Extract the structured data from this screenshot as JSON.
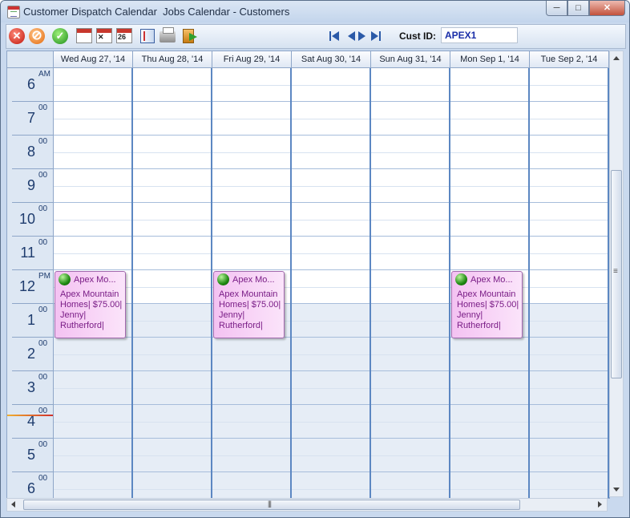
{
  "window": {
    "title": "Customer Dispatch Calendar  Jobs Calendar - Customers",
    "controls": {
      "minimize": "─",
      "maximize": "□",
      "close": "✕"
    }
  },
  "toolbar": {
    "buttons": [
      {
        "name": "delete-icon",
        "glyph": "✕"
      },
      {
        "name": "cancel-icon",
        "glyph": "⊘"
      },
      {
        "name": "confirm-icon",
        "glyph": "✓"
      },
      {
        "name": "go-to-today-icon",
        "glyph": ""
      },
      {
        "name": "delete-appointment-icon",
        "glyph": "✕"
      },
      {
        "name": "go-to-date-icon",
        "glyph": "26"
      },
      {
        "name": "notebook-icon",
        "glyph": ""
      },
      {
        "name": "printer-icon",
        "glyph": ""
      },
      {
        "name": "exit-door-icon",
        "glyph": ""
      }
    ],
    "nav": [
      "first-record-icon",
      "previous-record-icon",
      "next-record-icon",
      "last-record-icon"
    ],
    "cust_label": "Cust ID:",
    "cust_value": "APEX1"
  },
  "calendar": {
    "days": [
      "Wed Aug 27, '14",
      "Thu Aug 28, '14",
      "Fri Aug 29, '14",
      "Sat Aug 30, '14",
      "Sun Aug 31, '14",
      "Mon Sep 1, '14",
      "Tue Sep 2, '14"
    ],
    "hours": [
      {
        "hour": "6",
        "suffix": "AM"
      },
      {
        "hour": "7",
        "suffix": "00"
      },
      {
        "hour": "8",
        "suffix": "00"
      },
      {
        "hour": "9",
        "suffix": "00"
      },
      {
        "hour": "10",
        "suffix": "00"
      },
      {
        "hour": "11",
        "suffix": "00"
      },
      {
        "hour": "12",
        "suffix": "PM"
      },
      {
        "hour": "1",
        "suffix": "00"
      },
      {
        "hour": "2",
        "suffix": "00"
      },
      {
        "hour": "3",
        "suffix": "00"
      },
      {
        "hour": "4",
        "suffix": "00"
      },
      {
        "hour": "5",
        "suffix": "00"
      },
      {
        "hour": "6",
        "suffix": "00"
      }
    ],
    "appointments": [
      {
        "day": 0,
        "title": "Apex Mo...",
        "description": "Apex Mountain Homes| $75.00| Jenny| Rutherford|"
      },
      {
        "day": 2,
        "title": "Apex Mo...",
        "description": "Apex Mountain Homes| $75.00| Jenny| Rutherford|"
      },
      {
        "day": 5,
        "title": "Apex Mo...",
        "description": "Apex Mountain Homes| $75.00| Jenny| Rutherford|"
      }
    ]
  },
  "colors": {
    "work_hours_background": "#e6edf6",
    "day_separator": "#5c87c2",
    "appointment_text": "#7a1d86"
  }
}
